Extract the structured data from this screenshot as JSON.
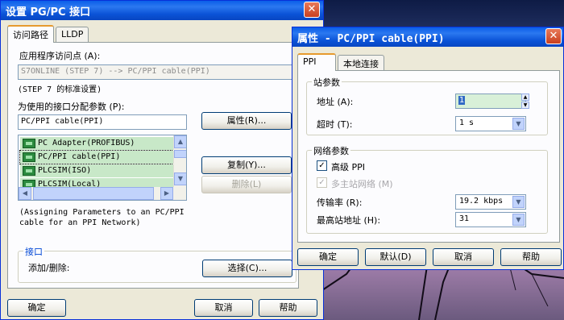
{
  "window_main": {
    "title": "设置 PG/PC 接口",
    "close_glyph": "✕",
    "tabs": [
      {
        "label": "访问路径"
      },
      {
        "label": "LLDP"
      }
    ],
    "access_point_label": "应用程序访问点 (A):",
    "access_point_value": "S7ONLINE      (STEP 7)        --> PC/PPI cable(PPI)",
    "standard_note": "(STEP 7 的标准设置)",
    "params_label": "为使用的接口分配参数 (P):",
    "params_value": "PC/PPI cable(PPI)",
    "list_items": [
      {
        "label": "PC Adapter(PROFIBUS)"
      },
      {
        "label": "PC/PPI cable(PPI)"
      },
      {
        "label": "PLCSIM(ISO)"
      },
      {
        "label": "PLCSIM(Local)"
      }
    ],
    "btn_properties": "属性(R)...",
    "btn_copy": "复制(Y)...",
    "btn_delete": "删除(L)",
    "description_line1": "(Assigning Parameters to an PC/PPI",
    "description_line2": "cable for an PPI Network)",
    "interface_group": "接口",
    "add_remove_label": "添加/删除:",
    "btn_select": "选择(C)...",
    "btn_ok": "确定",
    "btn_cancel": "取消",
    "btn_help": "帮助"
  },
  "window_props": {
    "title": "属性 - PC/PPI cable(PPI)",
    "close_glyph": "✕",
    "tabs": [
      {
        "label": "PPI"
      },
      {
        "label": "本地连接"
      }
    ],
    "station_group": "站参数",
    "address_label": "地址 (A):",
    "address_value": "1",
    "timeout_label": "超时 (T):",
    "timeout_value": "1 s",
    "network_group": "网络参数",
    "advanced_ppi_label": "高级 PPI",
    "advanced_ppi_checked": true,
    "multimaster_label": "多主站网络 (M)",
    "multimaster_checked": true,
    "baud_label": "传输率 (R):",
    "baud_value": "19.2 kbps",
    "highest_addr_label": "最高站地址 (H):",
    "highest_addr_value": "31",
    "btn_ok": "确定",
    "btn_default": "默认(D)",
    "btn_cancel": "取消",
    "btn_help": "帮助"
  },
  "colors": {
    "titlebar": "#0a52d6",
    "window_bg": "#ece9d8",
    "list_highlight": "#c8e8c8",
    "group_title": "#0046d5"
  }
}
